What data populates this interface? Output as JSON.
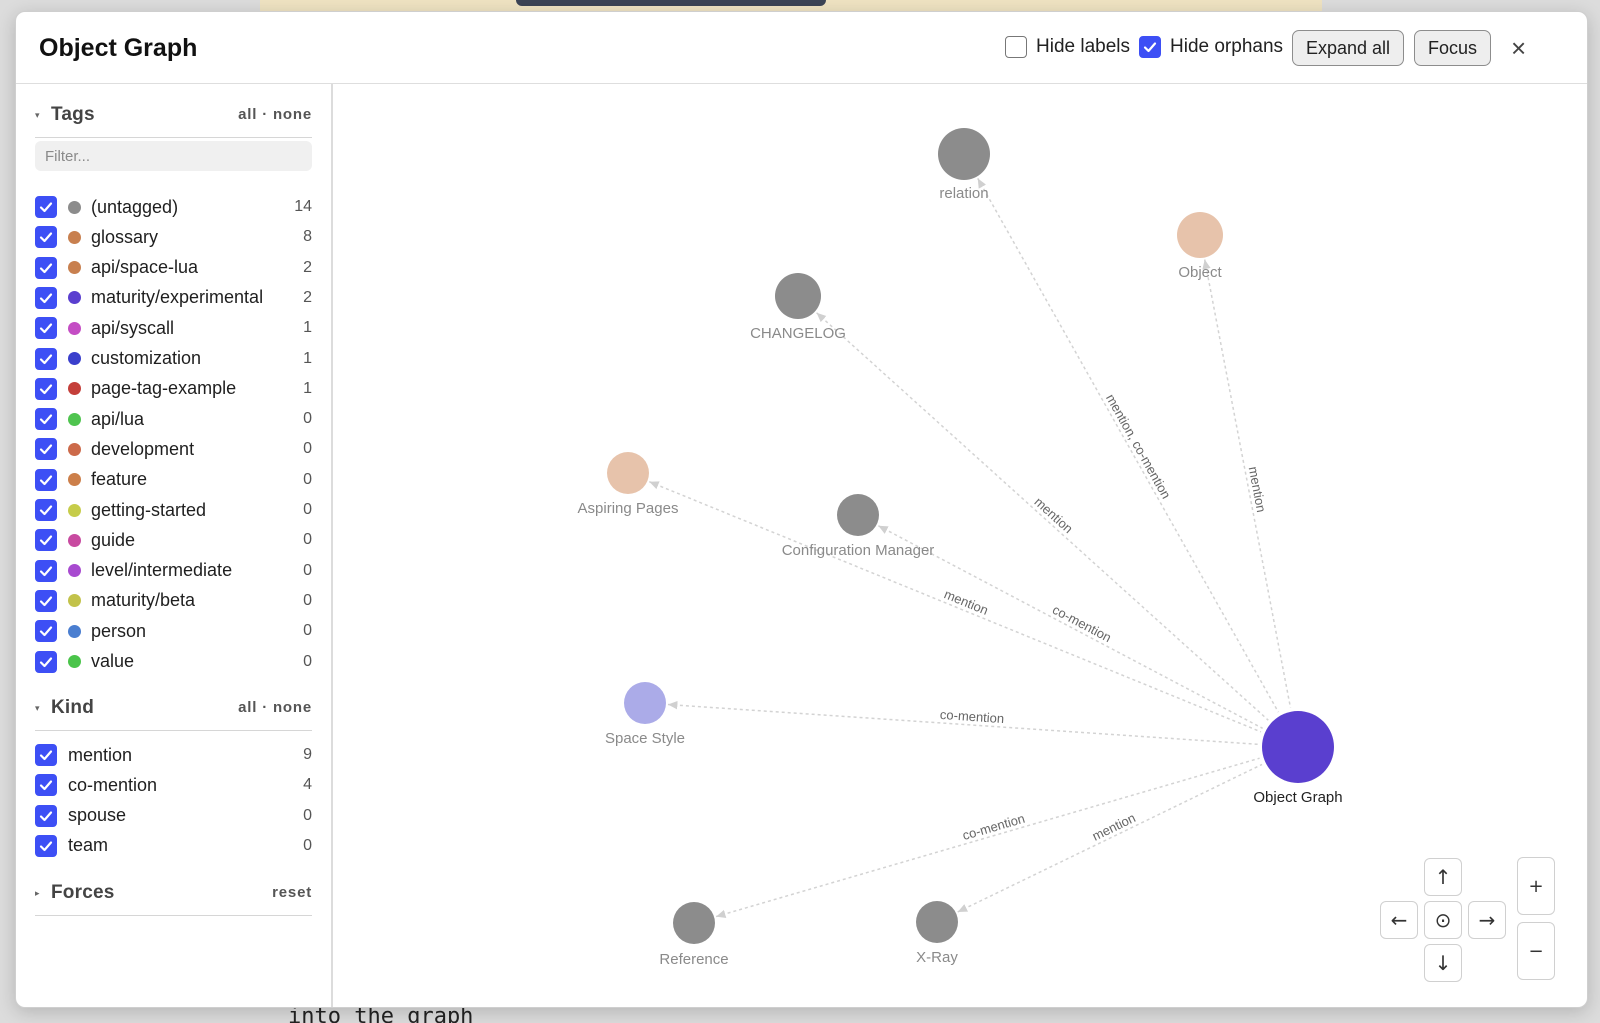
{
  "background": {
    "code_text": "into the graph"
  },
  "modal": {
    "title": "Object Graph",
    "hide_labels": {
      "label": "Hide labels",
      "checked": false
    },
    "hide_orphans": {
      "label": "Hide orphans",
      "checked": true
    },
    "expand_all_label": "Expand all",
    "focus_label": "Focus",
    "close_icon": "×"
  },
  "sidebar": {
    "tags": {
      "title": "Tags",
      "links": "all · none",
      "filter_placeholder": "Filter...",
      "items": [
        {
          "label": "(untagged)",
          "count": "14",
          "color": "#8c8c8c"
        },
        {
          "label": "glossary",
          "count": "8",
          "color": "#c8804f"
        },
        {
          "label": "api/space-lua",
          "count": "2",
          "color": "#c8804f"
        },
        {
          "label": "maturity/experimental",
          "count": "2",
          "color": "#5a3fcf"
        },
        {
          "label": "api/syscall",
          "count": "1",
          "color": "#c44dc4"
        },
        {
          "label": "customization",
          "count": "1",
          "color": "#3a3fcc"
        },
        {
          "label": "page-tag-example",
          "count": "1",
          "color": "#c43f3a"
        },
        {
          "label": "api/lua",
          "count": "0",
          "color": "#4fc44f"
        },
        {
          "label": "development",
          "count": "0",
          "color": "#cc6a4a"
        },
        {
          "label": "feature",
          "count": "0",
          "color": "#cc7f4a"
        },
        {
          "label": "getting-started",
          "count": "0",
          "color": "#c6cc4a"
        },
        {
          "label": "guide",
          "count": "0",
          "color": "#c84aa0"
        },
        {
          "label": "level/intermediate",
          "count": "0",
          "color": "#a84ad0"
        },
        {
          "label": "maturity/beta",
          "count": "0",
          "color": "#c2c24a"
        },
        {
          "label": "person",
          "count": "0",
          "color": "#4a7ed0"
        },
        {
          "label": "value",
          "count": "0",
          "color": "#4ac44a"
        }
      ]
    },
    "kind": {
      "title": "Kind",
      "links": "all · none",
      "items": [
        {
          "label": "mention",
          "count": "9"
        },
        {
          "label": "co-mention",
          "count": "4"
        },
        {
          "label": "spouse",
          "count": "0"
        },
        {
          "label": "team",
          "count": "0"
        }
      ]
    },
    "forces": {
      "title": "Forces",
      "link": "reset"
    }
  },
  "graph": {
    "nodes": [
      {
        "id": "relation",
        "label": "relation",
        "color": "#8c8c8c"
      },
      {
        "id": "object",
        "label": "Object",
        "color": "#e7c3ab"
      },
      {
        "id": "changelog",
        "label": "CHANGELOG",
        "color": "#8c8c8c"
      },
      {
        "id": "aspiring",
        "label": "Aspiring Pages",
        "color": "#e7c3ab"
      },
      {
        "id": "config",
        "label": "Configuration Manager",
        "color": "#8c8c8c"
      },
      {
        "id": "spacestyle",
        "label": "Space Style",
        "color": "#ababe8"
      },
      {
        "id": "objectgraph",
        "label": "Object Graph",
        "color": "#5a3fcf",
        "focus": true
      },
      {
        "id": "reference",
        "label": "Reference",
        "color": "#8c8c8c"
      },
      {
        "id": "xray",
        "label": "X-Ray",
        "color": "#8c8c8c"
      }
    ],
    "edges": [
      {
        "from": "relation",
        "to": "objectgraph",
        "label": "mention, co-mention"
      },
      {
        "from": "object",
        "to": "objectgraph",
        "label": "mention"
      },
      {
        "from": "changelog",
        "to": "objectgraph",
        "label": "mention"
      },
      {
        "from": "aspiring",
        "to": "objectgraph",
        "label": "mention"
      },
      {
        "from": "config",
        "to": "objectgraph",
        "label": "co-mention"
      },
      {
        "from": "spacestyle",
        "to": "objectgraph",
        "label": "co-mention"
      },
      {
        "from": "reference",
        "to": "objectgraph",
        "label": "co-mention"
      },
      {
        "from": "xray",
        "to": "objectgraph",
        "label": "mention"
      }
    ],
    "controls": {
      "up": "↑",
      "down": "↓",
      "left": "←",
      "right": "→",
      "center": "⊙",
      "zoom_in": "+",
      "zoom_out": "−"
    }
  }
}
